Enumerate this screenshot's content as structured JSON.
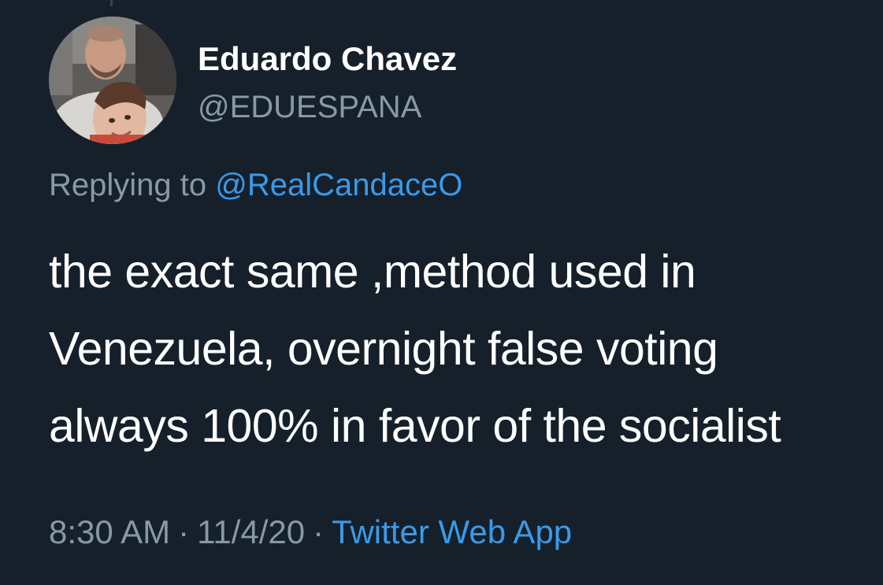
{
  "tweet": {
    "author": {
      "display_name": "Eduardo Chavez",
      "handle": "@EDUESPANA",
      "avatar": "profile-photo"
    },
    "reply": {
      "prefix": "Replying to",
      "mention": "@RealCandaceO"
    },
    "text_lines": [
      "the exact same ,method used in",
      "Venezuela, overnight false voting",
      "always 100% in favor of the socialist"
    ],
    "meta": {
      "time": "8:30 AM",
      "separator": "·",
      "date": "11/4/20",
      "source": "Twitter Web App"
    }
  },
  "colors": {
    "background": "#15202b",
    "text_primary": "#ffffff",
    "text_secondary": "#8899a6",
    "link": "#3a9ae8"
  }
}
